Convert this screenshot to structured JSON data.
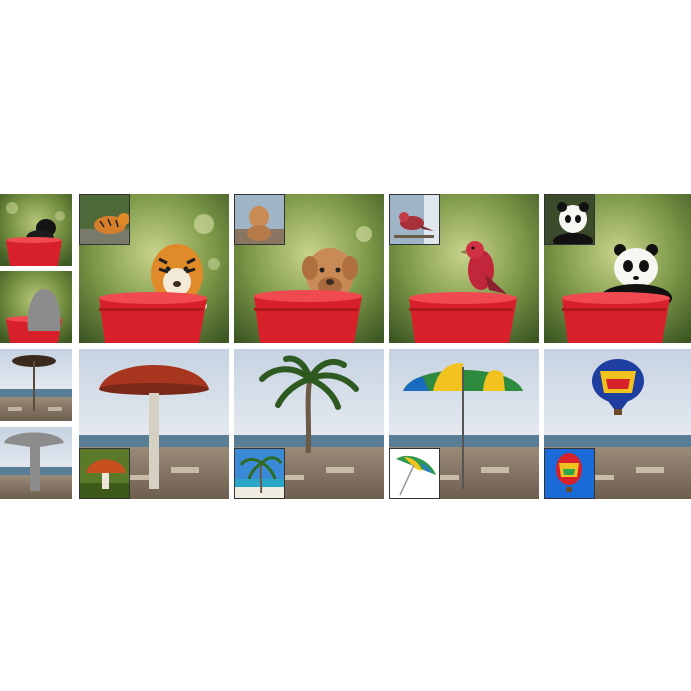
{
  "figure": {
    "rows": [
      {
        "name": "bucket-scene",
        "inputs": [
          "photo-black-puppy-in-bucket",
          "mask-gray-blob"
        ],
        "outputs": [
          {
            "reference": "tiger",
            "result": "tiger-in-red-bucket"
          },
          {
            "reference": "dog",
            "result": "dog-in-red-bucket"
          },
          {
            "reference": "red-bird",
            "result": "red-bird-on-bucket"
          },
          {
            "reference": "panda",
            "result": "panda-in-red-bucket"
          }
        ]
      },
      {
        "name": "beach-scene",
        "inputs": [
          "photo-straw-umbrella-on-beach",
          "mask-gray-umbrella-shape"
        ],
        "outputs": [
          {
            "reference": "mushroom",
            "result": "giant-mushroom-on-beach"
          },
          {
            "reference": "palm-tree",
            "result": "palm-tree-on-beach"
          },
          {
            "reference": "beach-umbrella",
            "result": "striped-umbrella-on-beach"
          },
          {
            "reference": "hot-air-balloon",
            "result": "balloon-over-beach"
          }
        ]
      }
    ]
  },
  "colors": {
    "bucket": "#d8202a",
    "foliage": "#6f8a3c",
    "sky": "#cfd9e6",
    "sea": "#5a7d96",
    "sand": "#8a7a6a",
    "mask": "#8c8c8c"
  }
}
